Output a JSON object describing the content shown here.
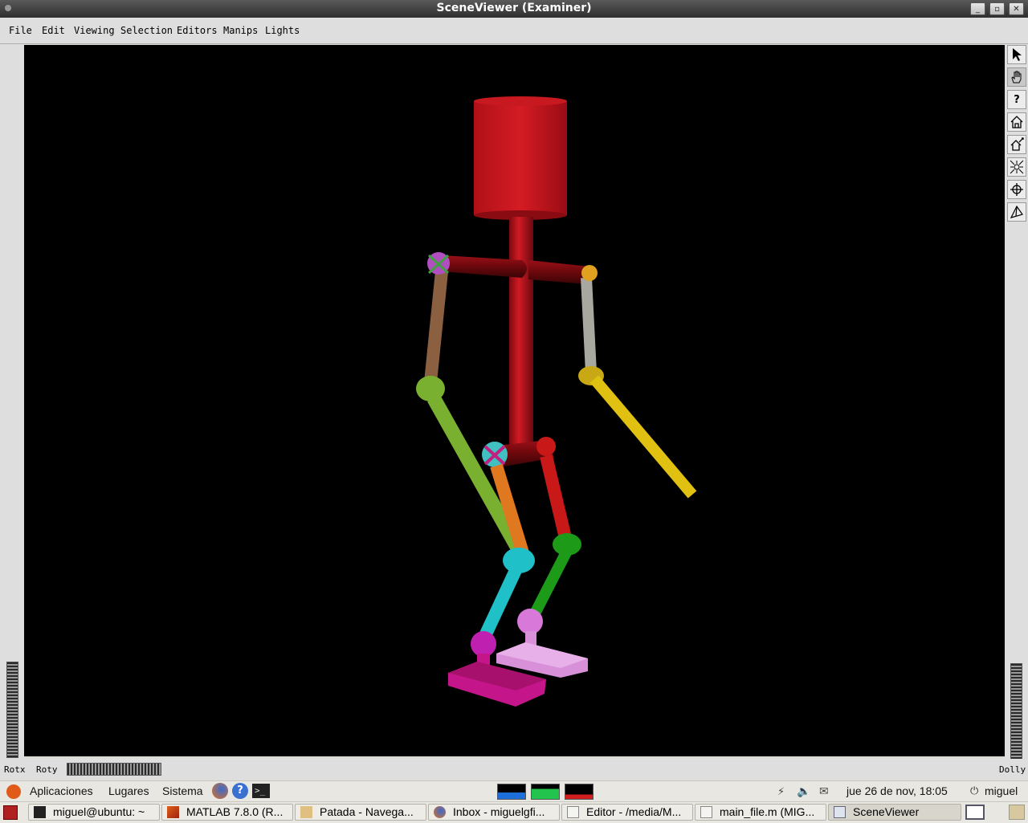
{
  "window": {
    "title": "SceneViewer (Examiner)",
    "controls": [
      "minimize-icon",
      "maximize-icon",
      "close-icon"
    ]
  },
  "menu": {
    "items": [
      "File",
      "Edit",
      "Viewing",
      "Selection",
      "Editors",
      "Manips",
      "Lights"
    ]
  },
  "viewer": {
    "background_color": "#000000",
    "toolbar_icons": [
      "pointer-icon",
      "hand-icon",
      "help-icon",
      "home-icon",
      "set-home-icon",
      "view-all-icon",
      "seek-icon",
      "perspective-icon"
    ],
    "left_wheel_label": "Rotx",
    "bottom_wheel_label": "Roty",
    "right_wheel_label": "Dolly"
  },
  "gnome_panel": {
    "menus": [
      "Aplicaciones",
      "Lugares",
      "Sistema"
    ],
    "launcher_icons": [
      "firefox-icon",
      "help-icon",
      "terminal-icon"
    ],
    "clock": "jue 26 de nov, 18:05",
    "user": "miguel",
    "system_monitor_colors": [
      "#1e6fd9",
      "#22c44e",
      "#d11e1e"
    ]
  },
  "taskbar": {
    "tasks": [
      {
        "label": "miguel@ubuntu: ~",
        "icon": "terminal-icon"
      },
      {
        "label": "MATLAB  7.8.0 (R...",
        "icon": "matlab-icon"
      },
      {
        "label": "Patada - Navega...",
        "icon": "folder-icon"
      },
      {
        "label": "Inbox - miguelgfi...",
        "icon": "firefox-icon"
      },
      {
        "label": "Editor - /media/M...",
        "icon": "editor-icon"
      },
      {
        "label": "main_file.m (MIG...",
        "icon": "editor-icon"
      },
      {
        "label": "SceneViewer",
        "icon": "window-icon"
      }
    ]
  },
  "colors": {
    "torso": "#b01018",
    "head": "#c0141c",
    "left_upper_arm": "#8a6040",
    "left_forearm": "#7ab030",
    "right_upper_arm": "#a8a8a0",
    "right_forearm": "#e0c010",
    "left_thigh": "#e07820",
    "left_shin": "#20c0c8",
    "right_thigh": "#c81818",
    "right_shin": "#1c9a18",
    "left_foot": "#c4168a",
    "right_foot": "#d890d8"
  }
}
